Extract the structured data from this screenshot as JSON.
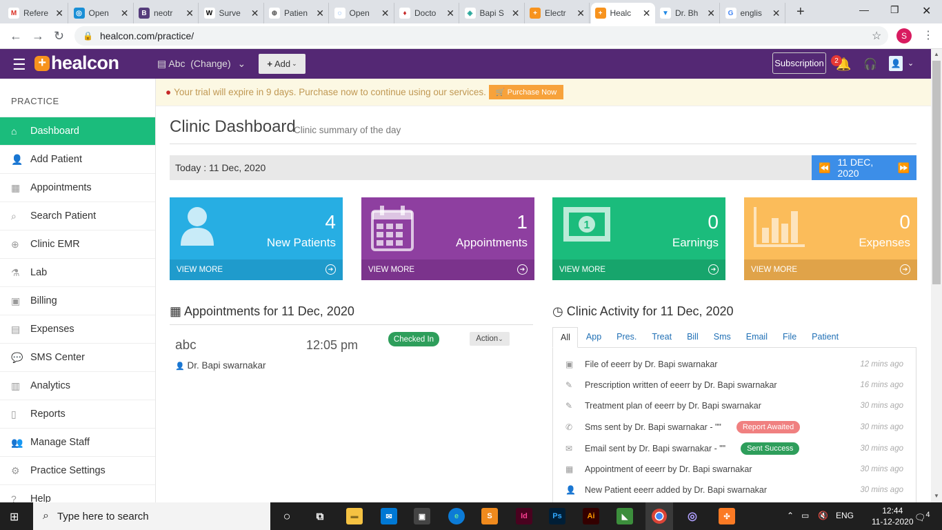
{
  "browser": {
    "tabs": [
      {
        "label": "Refere",
        "icon": "gmail-icon",
        "color": "#ffffff",
        "glyph": "M",
        "glyph_color": "#d93025"
      },
      {
        "label": "Open",
        "icon": "openemr-icon",
        "color": "#1a8fd6",
        "glyph": "◎",
        "glyph_color": "#ffffff"
      },
      {
        "label": "neotr",
        "icon": "b-icon",
        "color": "#563d7c",
        "glyph": "B",
        "glyph_color": "#ffffff"
      },
      {
        "label": "Surve",
        "icon": "wikipedia-icon",
        "color": "#ffffff",
        "glyph": "W",
        "glyph_color": "#000000"
      },
      {
        "label": "Patien",
        "icon": "globe-icon",
        "color": "#ffffff",
        "glyph": "⊕",
        "glyph_color": "#555555"
      },
      {
        "label": "Open",
        "icon": "loading-icon",
        "color": "#ffffff",
        "glyph": "◌",
        "glyph_color": "#1a73e8"
      },
      {
        "label": "Docto",
        "icon": "doctor-site-icon",
        "color": "#ffffff",
        "glyph": "♦",
        "glyph_color": "#c62828"
      },
      {
        "label": "Bapi S",
        "icon": "vue-icon",
        "color": "#ffffff",
        "glyph": "◈",
        "glyph_color": "#26a69a"
      },
      {
        "label": "Electr",
        "icon": "healcon-icon",
        "color": "#f7931e",
        "glyph": "+",
        "glyph_color": "#ffffff"
      },
      {
        "label": "Healc",
        "icon": "healcon-icon",
        "color": "#f7931e",
        "glyph": "+",
        "glyph_color": "#ffffff",
        "active": true
      },
      {
        "label": "Dr. Bh",
        "icon": "filter-icon",
        "color": "#ffffff",
        "glyph": "▼",
        "glyph_color": "#1e88e5"
      },
      {
        "label": "englis",
        "icon": "google-icon",
        "color": "#ffffff",
        "glyph": "G",
        "glyph_color": "#4285f4"
      }
    ],
    "url": "healcon.com/practice/",
    "profile_initial": "S"
  },
  "header": {
    "brand": "healcon",
    "clinic_name": "Abc",
    "change_label": "(Change)",
    "add_label": "Add",
    "subscription_label": "Subscription",
    "notif_count": "2"
  },
  "sidebar": {
    "title": "PRACTICE",
    "items": [
      {
        "label": "Dashboard",
        "icon": "home-icon",
        "glyph": "⌂",
        "active": true
      },
      {
        "label": "Add Patient",
        "icon": "add-user-icon",
        "glyph": "👤"
      },
      {
        "label": "Appointments",
        "icon": "calendar-icon",
        "glyph": "▦"
      },
      {
        "label": "Search Patient",
        "icon": "search-icon",
        "glyph": "⌕"
      },
      {
        "label": "Clinic EMR",
        "icon": "plus-circle-icon",
        "glyph": "⊕"
      },
      {
        "label": "Lab",
        "icon": "flask-icon",
        "glyph": "⚗"
      },
      {
        "label": "Billing",
        "icon": "money-icon",
        "glyph": "▣"
      },
      {
        "label": "Expenses",
        "icon": "table-icon",
        "glyph": "▤"
      },
      {
        "label": "SMS Center",
        "icon": "chat-icon",
        "glyph": "💬"
      },
      {
        "label": "Analytics",
        "icon": "bar-chart-icon",
        "glyph": "▥"
      },
      {
        "label": "Reports",
        "icon": "book-icon",
        "glyph": "▯"
      },
      {
        "label": "Manage Staff",
        "icon": "users-icon",
        "glyph": "👥"
      },
      {
        "label": "Practice Settings",
        "icon": "cogs-icon",
        "glyph": "⚙"
      },
      {
        "label": "Help",
        "icon": "help-icon",
        "glyph": "?"
      }
    ]
  },
  "trial": {
    "message": "Your trial will expire in 9 days. Purchase now to continue using our services.",
    "purchase_label": "Purchase Now"
  },
  "dashboard": {
    "title": "Clinic Dashboard",
    "subtitle": "Clinic summary of the day",
    "today_label": "Today : 11 Dec, 2020",
    "date_nav_label": "11 DEC, 2020",
    "cards": [
      {
        "value": "4",
        "label": "New Patients",
        "more": "VIEW MORE",
        "color": "#27aee3",
        "foot_color": "#1f9bcc",
        "icon": "user-icon"
      },
      {
        "value": "1",
        "label": "Appointments",
        "more": "VIEW MORE",
        "color": "#8e3fa0",
        "foot_color": "#7b338c",
        "icon": "calendar-icon"
      },
      {
        "value": "0",
        "label": "Earnings",
        "more": "VIEW MORE",
        "color": "#1bbc7c",
        "foot_color": "#17a56c",
        "icon": "money-icon"
      },
      {
        "value": "0",
        "label": "Expenses",
        "more": "VIEW MORE",
        "color": "#fbbc5a",
        "foot_color": "#e0a349",
        "icon": "bar-chart-icon"
      }
    ]
  },
  "appointments": {
    "heading": "Appointments for 11 Dec, 2020",
    "items": [
      {
        "patient": "abc",
        "time": "12:05 pm",
        "status": "Checked In",
        "action": "Action",
        "doctor": "Dr. Bapi swarnakar"
      }
    ]
  },
  "activity": {
    "heading": "Clinic Activity for 11 Dec, 2020",
    "tabs": [
      "All",
      "App",
      "Pres.",
      "Treat",
      "Bill",
      "Sms",
      "Email",
      "File",
      "Patient"
    ],
    "items": [
      {
        "text": "File of eeerr by Dr. Bapi swarnakar",
        "time": "12 mins ago",
        "icon": "file-icon",
        "glyph": "▣"
      },
      {
        "text": "Prescription written of eeerr by Dr. Bapi swarnakar",
        "time": "16 mins ago",
        "icon": "edit-icon",
        "glyph": "✎"
      },
      {
        "text": "Treatment plan of eeerr by Dr. Bapi swarnakar",
        "time": "30 mins ago",
        "icon": "edit-icon",
        "glyph": "✎"
      },
      {
        "text": "Sms sent by Dr. Bapi swarnakar - \"\"",
        "time": "30 mins ago",
        "icon": "phone-icon",
        "glyph": "✆",
        "pill": "Report Awaited",
        "pill_color": "#f08080"
      },
      {
        "text": "Email sent by Dr. Bapi swarnakar - \"\"",
        "time": "30 mins ago",
        "icon": "envelope-icon",
        "glyph": "✉",
        "pill": "Sent Success",
        "pill_color": "#2e9e5b"
      },
      {
        "text": "Appointment of eeerr by Dr. Bapi swarnakar",
        "time": "30 mins ago",
        "icon": "calendar-icon",
        "glyph": "▦"
      },
      {
        "text": "New Patient eeerr added by Dr. Bapi swarnakar",
        "time": "30 mins ago",
        "icon": "user-icon",
        "glyph": "👤"
      }
    ]
  },
  "taskbar": {
    "search_placeholder": "Type here to search",
    "language": "ENG",
    "time": "12:44",
    "date": "11-12-2020",
    "notif_count": "4"
  }
}
